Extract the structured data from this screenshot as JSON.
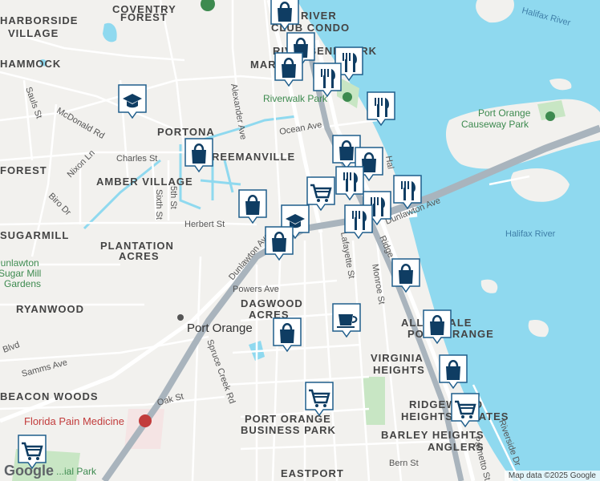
{
  "map": {
    "water_color": "#8fd9ef",
    "land_color": "#f2f1ee",
    "road_color": "#ffffff",
    "highway_color": "#a9b4bd",
    "park_color": "#c8e6c4",
    "canal_color": "#8fd9ef"
  },
  "neighborhoods": {
    "coventry_forest_1": "COVENTRY",
    "coventry_forest_2": "FOREST",
    "harborside_1": "HARBORSIDE",
    "harborside_2": "VILLAGE",
    "hammock": "HAMMOCK",
    "forest": "FOREST",
    "portona": "PORTONA",
    "freemanville": "FREEMANVILLE",
    "amber_village": "AMBER VILLAGE",
    "sugarmill": "SUGARMILL",
    "plantation_1": "PLANTATION",
    "plantation_2": "ACRES",
    "ryanwood": "RYANWOOD",
    "dagwood_1": "DAGWOOD",
    "dagwood_2": "ACRES",
    "virginia": "VIRGINIA",
    "heights": "HEIGHTS",
    "beacon_woods": "BEACON WOODS",
    "ridgewood_1": "RIDGEWOOD",
    "ridgewood_2": "HEIGHTS ESTATES",
    "barley_heights": "BARLEY HEIGHTS",
    "anglers": "ANGLERS",
    "port_orange_bp_1": "PORT ORANGE",
    "port_orange_bp_2": "BUSINESS PARK",
    "eastport": "EASTPORT",
    "allandale_1": "ALLANDALE",
    "allandale_2": "PORT ORANGE",
    "river_condo_1": "RIVER",
    "river_condo_2": "CLUB CONDO",
    "riverbend_park": "RIVERBEND PARK",
    "marsh": "MARSH"
  },
  "streets": {
    "sauls": "Sauls St",
    "mcdonald": "McDonald Rd",
    "nixon": "Nixon Ln",
    "biro": "Biro Dr",
    "charles": "Charles St",
    "alexander": "Alexander Ave",
    "ocean": "Ocean Ave",
    "fifth": "5th St",
    "sixth": "Sixth St",
    "herbert": "Herbert St",
    "dunlawton_w": "Dunlawton Ave",
    "dunlawton_e": "Dunlawton Ave",
    "powers": "Powers Ave",
    "lafayette": "Lafayette St",
    "monroe": "Monroe St",
    "ridge": "Ridge",
    "ridge_blvd": "Blvd",
    "spruce_creek": "Spruce Creek Rd",
    "samms": "Samms Ave",
    "oak": "Oak St",
    "bern": "Bern St",
    "riverside": "Riverside Dr",
    "palmetto": "Palmetto St",
    "hal": "Hal"
  },
  "places": {
    "city": "Port Orange",
    "halifax_river_1": "Halifax River",
    "halifax_river_2": "Halifax River",
    "riverwalk_park": "Riverwalk Park",
    "causeway_park_1": "Port Orange",
    "causeway_park_2": "Causeway Park",
    "dunlawton_sugar_1": "Dunlawton",
    "dunlawton_sugar_2": "Sugar Mill",
    "dunlawton_sugar_3": "Gardens",
    "florida_pain": "Florida Pain Medicine",
    "memorial_park": "...ial Park"
  },
  "pins": [
    {
      "kind": "shopping-bag-icon"
    },
    {
      "kind": "shopping-bag-icon"
    },
    {
      "kind": "restaurant-icon"
    },
    {
      "kind": "shopping-bag-icon"
    },
    {
      "kind": "restaurant-icon"
    },
    {
      "kind": "restaurant-icon"
    },
    {
      "kind": "school-icon"
    },
    {
      "kind": "shopping-bag-icon"
    },
    {
      "kind": "shopping-bag-icon"
    },
    {
      "kind": "shopping-bag-icon"
    },
    {
      "kind": "restaurant-icon"
    },
    {
      "kind": "grocery-cart-icon"
    },
    {
      "kind": "shopping-bag-icon"
    },
    {
      "kind": "restaurant-icon"
    },
    {
      "kind": "school-icon"
    },
    {
      "kind": "restaurant-icon"
    },
    {
      "kind": "restaurant-icon"
    },
    {
      "kind": "shopping-bag-icon"
    },
    {
      "kind": "shopping-bag-icon"
    },
    {
      "kind": "cafe-icon"
    },
    {
      "kind": "shopping-bag-icon"
    },
    {
      "kind": "shopping-bag-icon"
    },
    {
      "kind": "shopping-bag-icon"
    },
    {
      "kind": "grocery-cart-icon"
    },
    {
      "kind": "grocery-cart-icon"
    },
    {
      "kind": "grocery-cart-icon"
    }
  ],
  "footer": {
    "logo": "Google",
    "attribution": "Map data ©2025 Google"
  }
}
